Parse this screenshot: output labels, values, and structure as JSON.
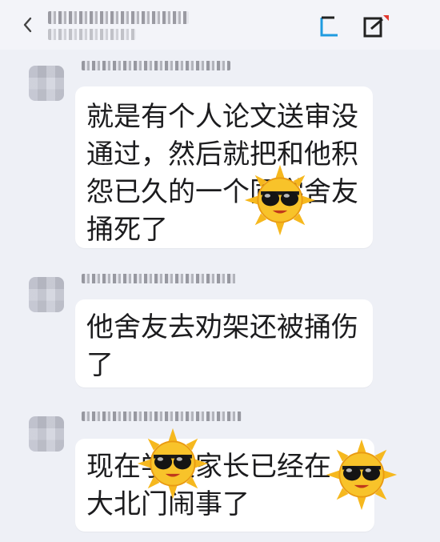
{
  "chat": {
    "messages": [
      {
        "text": "就是有个人论文送审没\n通过，然后就把和他积\n怨已久的一个同学舍友\n捅死了"
      },
      {
        "text": "他舍友去劝架还被捅伤\n了"
      },
      {
        "text": "现在学校家长已经在\n大北门闹事了"
      }
    ]
  },
  "icons": {
    "back": "chevron-left-icon",
    "header_left": "bracket-icon",
    "header_right": "edit-icon",
    "sticker": "sunglasses-sun-emoji"
  },
  "colors": {
    "background": "#eef0f6",
    "bubble": "#ffffff",
    "text": "#1c1c1e",
    "accent": "#1f9be0",
    "notify": "#e3372e",
    "sun": "#f6b81e"
  }
}
